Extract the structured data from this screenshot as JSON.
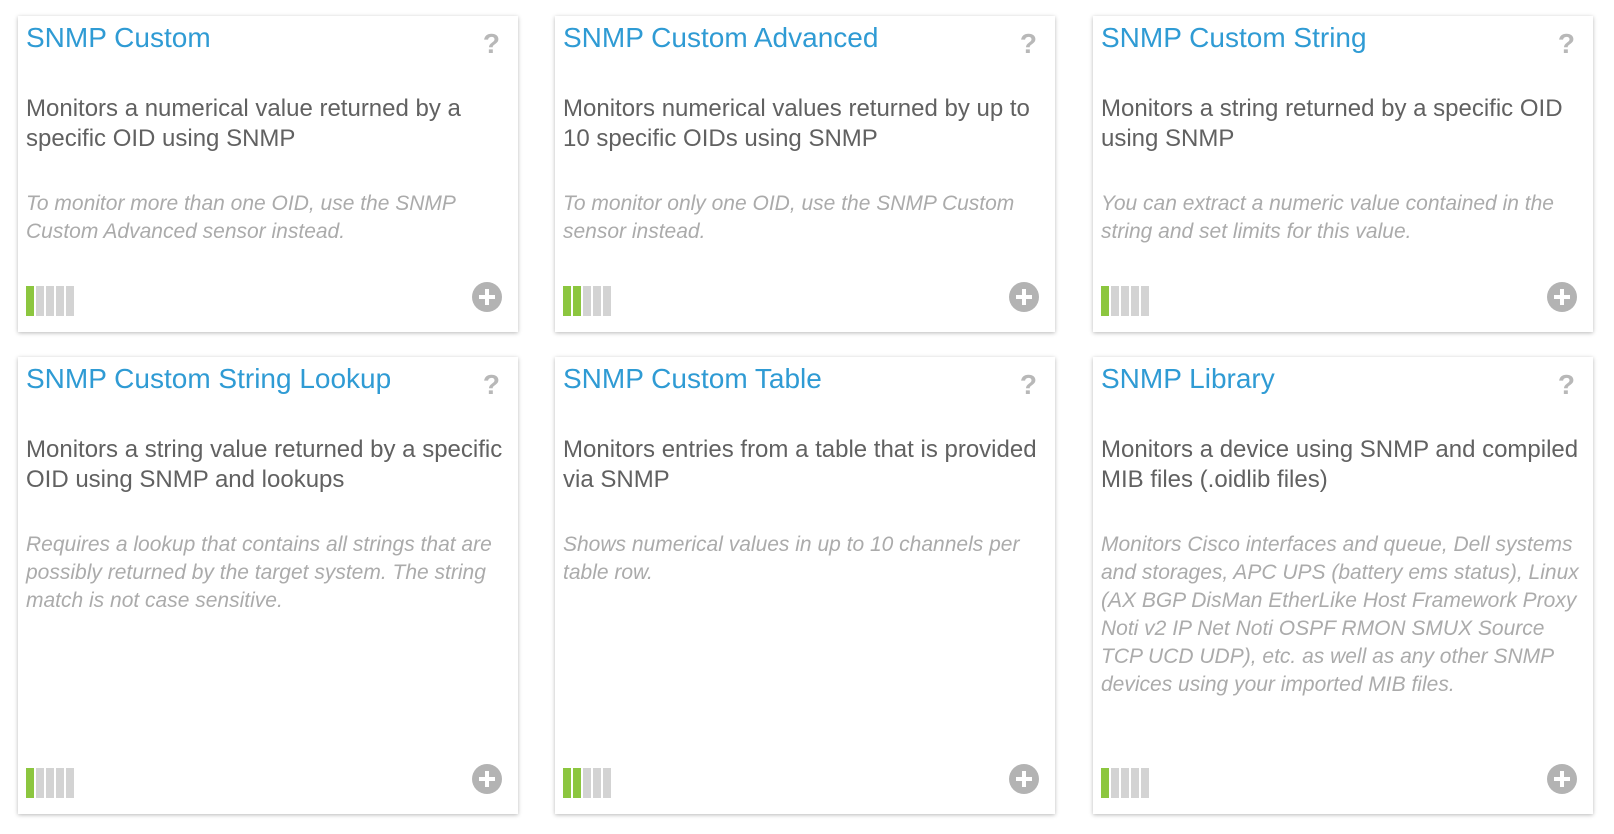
{
  "colors": {
    "title": "#2f9bd4",
    "meter_active": "#8cc63f",
    "meter_inactive": "#d3d3d3",
    "icon_grey": "#b3b3b3"
  },
  "icons": {
    "help": "?",
    "add": "plus-circle-icon"
  },
  "cards": [
    {
      "title": "SNMP Custom",
      "description": "Monitors a numerical value returned by a specific OID using SNMP",
      "note": "To monitor more than one OID, use the SNMP Custom Advanced sensor instead.",
      "performance_level": 1,
      "performance_max": 5
    },
    {
      "title": "SNMP Custom Advanced",
      "description": "Monitors numerical values returned by up to 10 specific OIDs using SNMP",
      "note": "To monitor only one OID, use the SNMP Custom sensor instead.",
      "performance_level": 2,
      "performance_max": 5
    },
    {
      "title": "SNMP Custom String",
      "description": "Monitors a string returned by a specific OID using SNMP",
      "note": "You can extract a numeric value contained in the string and set limits for this value.",
      "performance_level": 1,
      "performance_max": 5
    },
    {
      "title": "SNMP Custom String Lookup",
      "description": "Monitors a string value returned by a specific OID using SNMP and lookups",
      "note": "Requires a lookup that contains all strings that are possibly returned by the target system. The string match is not case sensitive.",
      "performance_level": 1,
      "performance_max": 5
    },
    {
      "title": "SNMP Custom Table",
      "description": "Monitors entries from a table that is provided via SNMP",
      "note": "Shows numerical values in up to 10 channels per table row.",
      "performance_level": 2,
      "performance_max": 5
    },
    {
      "title": "SNMP Library",
      "description": "Monitors a device using SNMP and compiled MIB files (.oidlib files)",
      "note": "Monitors Cisco interfaces and queue, Dell systems and storages, APC UPS (battery ems status), Linux (AX BGP DisMan EtherLike Host Framework Proxy Noti v2 IP Net Noti OSPF RMON SMUX Source TCP UCD UDP), etc. as well as any other SNMP devices using your imported MIB files.",
      "performance_level": 1,
      "performance_max": 5
    }
  ]
}
